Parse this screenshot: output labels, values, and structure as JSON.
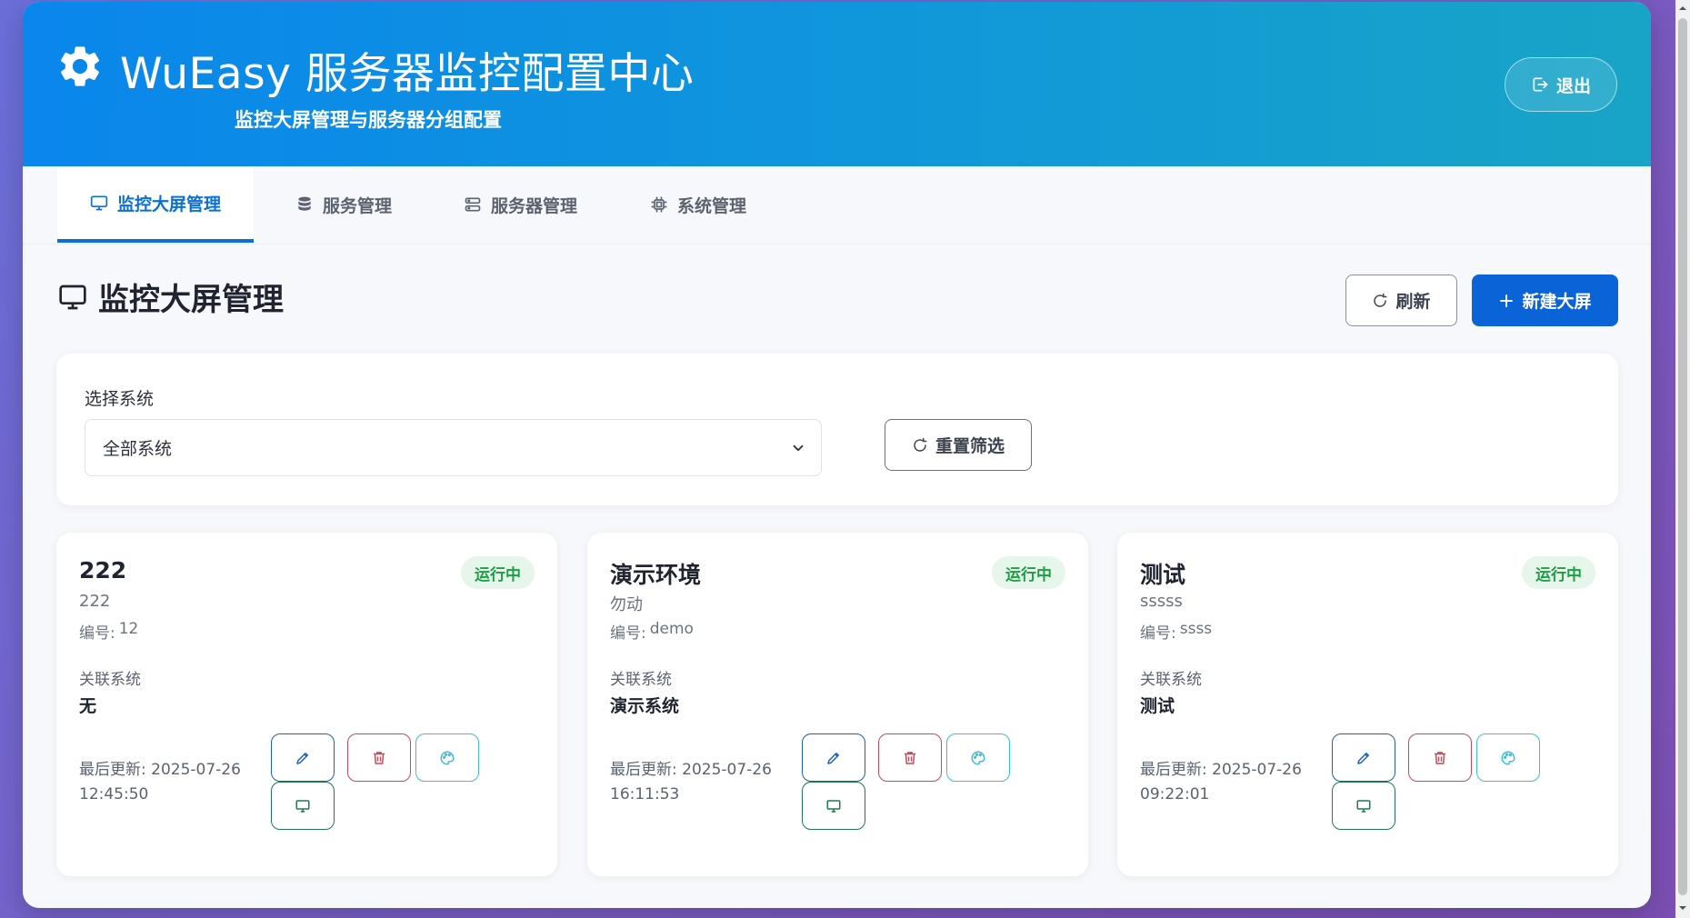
{
  "header": {
    "title": "WuEasy 服务器监控配置中心",
    "subtitle": "监控大屏管理与服务器分组配置",
    "logout_label": "退出",
    "gear_icon": "gear-icon"
  },
  "tabs": [
    {
      "label": "监控大屏管理",
      "icon": "monitor-icon",
      "active": true
    },
    {
      "label": "服务管理",
      "icon": "database-icon",
      "active": false
    },
    {
      "label": "服务器管理",
      "icon": "server-icon",
      "active": false
    },
    {
      "label": "系统管理",
      "icon": "cpu-icon",
      "active": false
    }
  ],
  "page": {
    "title": "监控大屏管理",
    "refresh_label": "刷新",
    "new_label": "新建大屏"
  },
  "filter": {
    "label": "选择系统",
    "selected": "全部系统",
    "reset_label": "重置筛选"
  },
  "card_labels": {
    "code_prefix": "编号:",
    "related_label": "关联系统",
    "updated_prefix": "最后更新:"
  },
  "cards": [
    {
      "name": "222",
      "status": "运行中",
      "desc": "222",
      "code": "12",
      "related": "无",
      "date": "2025-07-26",
      "time": "12:45:50"
    },
    {
      "name": "演示环境",
      "status": "运行中",
      "desc": "勿动",
      "code": "demo",
      "related": "演示系统",
      "date": "2025-07-26",
      "time": "16:11:53"
    },
    {
      "name": "测试",
      "status": "运行中",
      "desc": "sssss",
      "code": "ssss",
      "related": "测试",
      "date": "2025-07-26",
      "time": "09:22:01"
    }
  ],
  "colors": {
    "primary": "#0b63d8",
    "header_start": "#0a86ec",
    "header_end": "#18a4c6",
    "status_bg": "#e6f6ea",
    "status_text": "#1f9d46",
    "delete": "#c9485a",
    "theme": "#3bbfd4",
    "view": "#1f7a4d"
  }
}
